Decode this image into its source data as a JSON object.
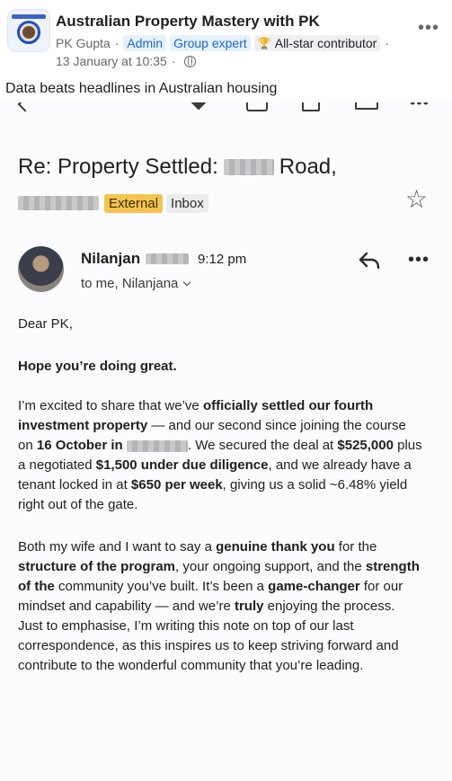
{
  "post": {
    "group_name": "Australian Property Mastery with PK",
    "author": "PK Gupta",
    "badges": [
      "Admin",
      "Group expert",
      "All-star contributor"
    ],
    "date": "13 January at 10:35",
    "text": "Data beats headlines in Australian housing"
  },
  "email": {
    "subject_prefix": "Re: Property Settled:",
    "subject_suffix": "Road,",
    "labels": [
      "External",
      "Inbox"
    ],
    "sender_name": "Nilanjan",
    "time": "9:12 pm",
    "recipients": "to me, Nilanjana",
    "greeting": "Dear PK,",
    "hope": "Hope you’re doing great.",
    "p1": [
      {
        "t": "I’m excited to share that we’ve "
      },
      {
        "t": "officially settled our fourth investment property",
        "b": true
      },
      {
        "t": " — and our second since joining the course on "
      },
      {
        "t": "16 October in",
        "b": true
      },
      {
        "t": " "
      },
      {
        "redact": true
      },
      {
        "t": ". We secured the deal at "
      },
      {
        "t": "$525,000",
        "b": true
      },
      {
        "t": " plus a negotiated "
      },
      {
        "t": "$1,500 under due diligence",
        "b": true
      },
      {
        "t": ", and we already have a tenant locked in at "
      },
      {
        "t": "$650 per week",
        "b": true
      },
      {
        "t": ", giving us a solid ~6.48% yield right out of the gate."
      }
    ],
    "p2": [
      {
        "t": "Both my wife and I want to say a "
      },
      {
        "t": "genuine thank you",
        "b": true
      },
      {
        "t": " for the "
      },
      {
        "t": "structure of the program",
        "b": true
      },
      {
        "t": ", your ongoing support, and the "
      },
      {
        "t": "strength of the",
        "b": true
      },
      {
        "t": " community you’ve built. It’s been a "
      },
      {
        "t": "game-changer",
        "b": true
      },
      {
        "t": " for our mindset and capability — and we’re "
      },
      {
        "t": "truly",
        "b": true
      },
      {
        "t": " enjoying the process. Just to emphasise, I’m writing this note on top of our last correspondence, as  this inspires us to keep striving forward and contribute to the wonderful community that you’re leading."
      }
    ]
  }
}
